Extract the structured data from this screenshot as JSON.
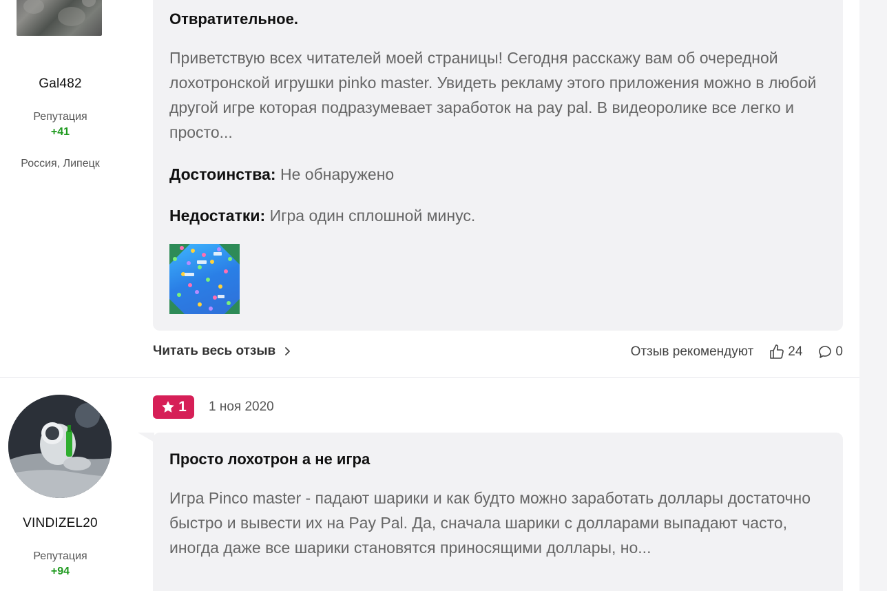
{
  "reviews": [
    {
      "author": {
        "name": "Gal482",
        "reputation_label": "Репутация",
        "reputation_value": "+41",
        "location": "Россия, Липецк"
      },
      "title": "Отвратительное.",
      "text": "Приветствую всех читателей моей страницы! Сегодня расскажу вам об очередной лохотронской игрушки pinko master. Увидеть рекламу этого приложения можно в любой другой игре которая подразумевает заработок на pay pal. В видеоролике все легко и просто...",
      "pros_label": "Достоинства:",
      "pros_value": "Не обнаружено",
      "cons_label": "Недостатки:",
      "cons_value": "Игра один сплошной минус.",
      "read_more": "Читать весь отзыв",
      "recommend_label": "Отзыв рекомендуют",
      "likes": "24",
      "comments": "0"
    },
    {
      "author": {
        "name": "VINDIZEL20",
        "reputation_label": "Репутация",
        "reputation_value": "+94"
      },
      "rating": "1",
      "date": "1 ноя 2020",
      "title": "Просто лохотрон а не игра",
      "text": "Игра Pinco master - падают шарики и как будто можно заработать доллары достаточно быстро и вывести их на Pay Pal. Да, сначала шарики с долларами выпадают часто, иногда даже все шарики становятся приносящими доллары, но..."
    }
  ],
  "colors": {
    "accent": "#d61f57",
    "reputation": "#1f9a1f",
    "card_bg": "#f2f2f4"
  },
  "icons": [
    "thumbs-up-icon",
    "comment-icon",
    "star-icon",
    "chevron-right-icon"
  ]
}
